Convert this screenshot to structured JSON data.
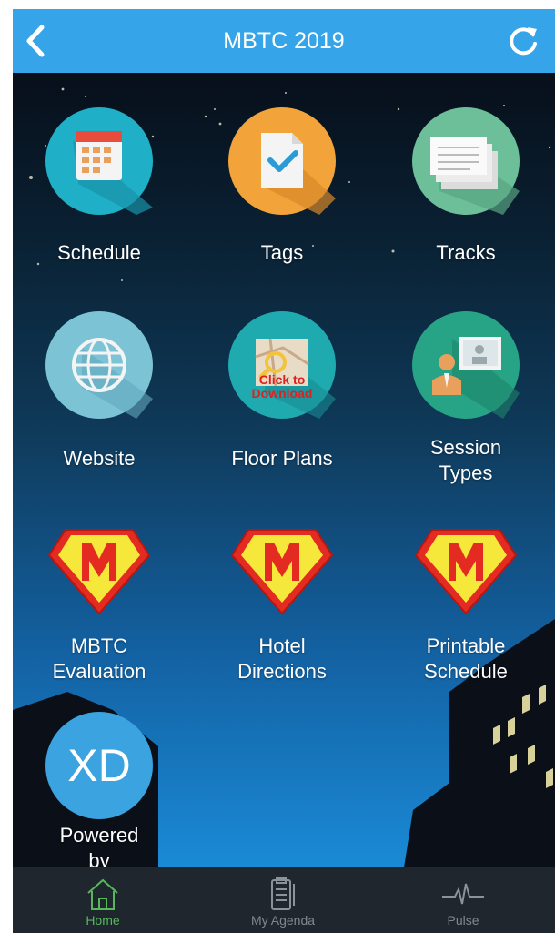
{
  "header": {
    "title": "MBTC 2019",
    "accent": "#35a4e8"
  },
  "grid": {
    "tiles": [
      {
        "label": "Schedule",
        "icon": "calendar-icon"
      },
      {
        "label": "Tags",
        "icon": "document-check-icon"
      },
      {
        "label": "Tracks",
        "icon": "stacked-pages-icon"
      },
      {
        "label": "Website",
        "icon": "globe-icon"
      },
      {
        "label": "Floor Plans",
        "icon": "map-icon",
        "overlay": [
          "Click to",
          "Download"
        ]
      },
      {
        "label_lines": [
          "Session",
          "Types"
        ],
        "icon": "presenter-icon"
      },
      {
        "label_lines": [
          "MBTC",
          "Evaluation"
        ],
        "icon": "superhero-m-icon"
      },
      {
        "label_lines": [
          "Hotel",
          "Directions"
        ],
        "icon": "superhero-m-icon"
      },
      {
        "label_lines": [
          "Printable",
          "Schedule"
        ],
        "icon": "superhero-m-icon"
      },
      {
        "label_lines": [
          "Powered",
          "by"
        ],
        "icon": "xd-logo-icon",
        "logo_text": "XD"
      }
    ]
  },
  "tabbar": {
    "tabs": [
      {
        "label": "Home",
        "icon": "home-icon",
        "active": true
      },
      {
        "label": "My Agenda",
        "icon": "clipboard-icon",
        "active": false
      },
      {
        "label": "Pulse",
        "icon": "pulse-icon",
        "active": false
      }
    ],
    "active_color": "#56b85b"
  }
}
